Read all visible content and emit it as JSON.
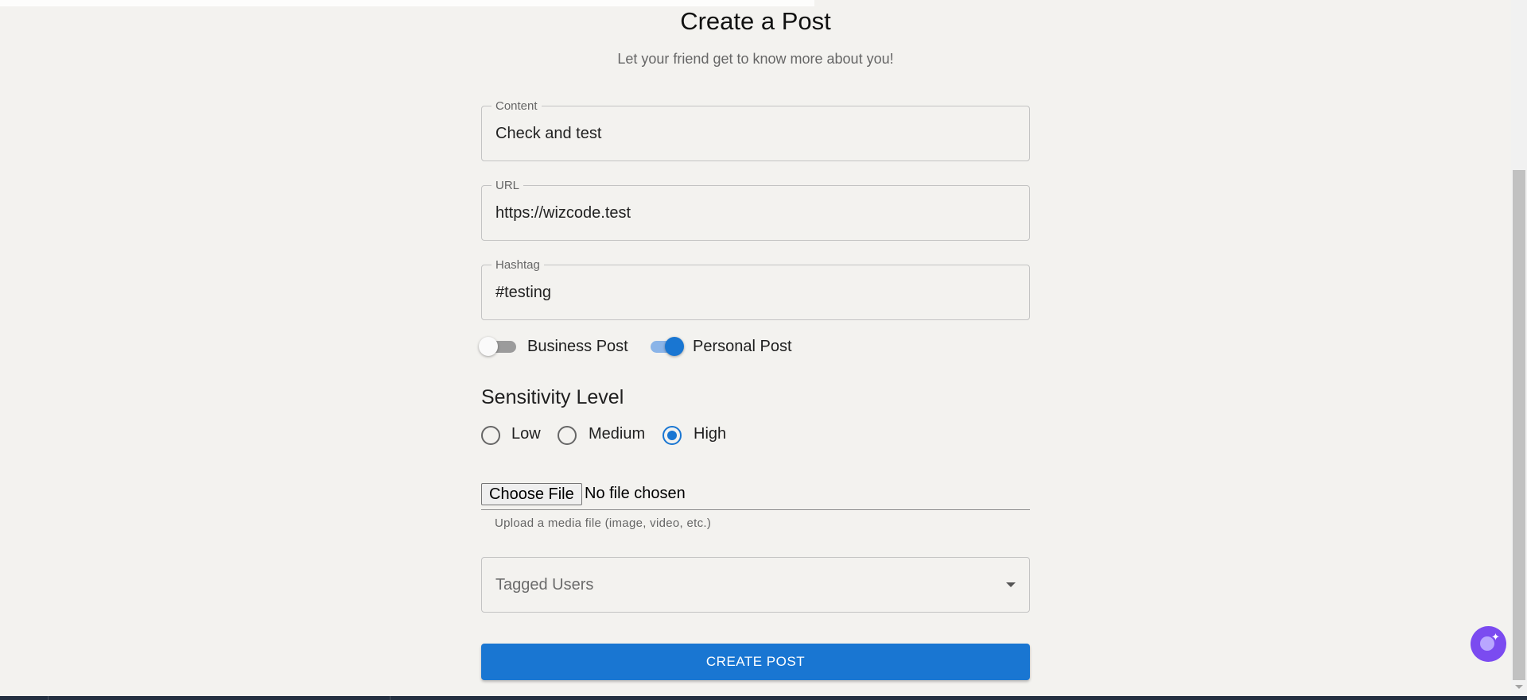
{
  "header": {
    "title": "Create a Post",
    "subtitle": "Let your friend get to know more about you!"
  },
  "fields": {
    "content": {
      "label": "Content",
      "value": "Check and test"
    },
    "url": {
      "label": "URL",
      "value": "https://wizcode.test"
    },
    "hashtag": {
      "label": "Hashtag",
      "value": "#testing"
    }
  },
  "switches": {
    "business": {
      "label": "Business Post",
      "checked": false
    },
    "personal": {
      "label": "Personal Post",
      "checked": true
    }
  },
  "sensitivity": {
    "title": "Sensitivity Level",
    "options": [
      {
        "label": "Low",
        "checked": false
      },
      {
        "label": "Medium",
        "checked": false
      },
      {
        "label": "High",
        "checked": true
      }
    ]
  },
  "file_upload": {
    "button_label": "Choose File",
    "status": "No file chosen",
    "helper": "Upload a media file (image, video, etc.)"
  },
  "tagged_users": {
    "placeholder": "Tagged Users"
  },
  "submit": {
    "label": "CREATE POST"
  },
  "colors": {
    "primary": "#1976d2",
    "background": "#f3f2ef",
    "assistant_fab": "#7b4bf0"
  },
  "icons": {
    "fab": "assistant-sparkle-icon",
    "select_arrow": "caret-down-icon"
  }
}
